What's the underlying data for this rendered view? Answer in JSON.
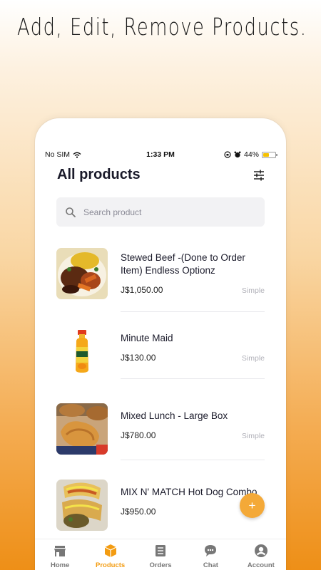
{
  "headline": "Add, Edit, Remove Products.",
  "status_bar": {
    "carrier": "No SIM",
    "time": "1:33 PM",
    "battery_text": "44%",
    "battery_level": 0.44
  },
  "header": {
    "title": "All products"
  },
  "search": {
    "placeholder": "Search product"
  },
  "products": [
    {
      "name": "Stewed Beef -(Done to Order Item) Endless Optionz",
      "price": "J$1,050.00",
      "type": "Simple",
      "image": "stewed-beef-plate"
    },
    {
      "name": "Minute Maid",
      "price": "J$130.00",
      "type": "Simple",
      "image": "juice-bottle"
    },
    {
      "name": "Mixed Lunch - Large Box",
      "price": "J$780.00",
      "type": "Simple",
      "image": "chicken-box"
    },
    {
      "name": "MIX N' MATCH Hot Dog Combo",
      "price": "J$950.00",
      "type": "",
      "image": "hot-dog-combo"
    }
  ],
  "fab": {
    "label": "+"
  },
  "tabbar": {
    "items": [
      {
        "label": "Home",
        "icon": "store-icon"
      },
      {
        "label": "Products",
        "icon": "box-icon"
      },
      {
        "label": "Orders",
        "icon": "orders-icon"
      },
      {
        "label": "Chat",
        "icon": "chat-icon"
      },
      {
        "label": "Account",
        "icon": "account-icon"
      }
    ],
    "active": "Products"
  },
  "colors": {
    "accent": "#f39c12",
    "fab": "#f4a938",
    "text": "#1a1a2a",
    "muted": "#b0b0b8"
  }
}
